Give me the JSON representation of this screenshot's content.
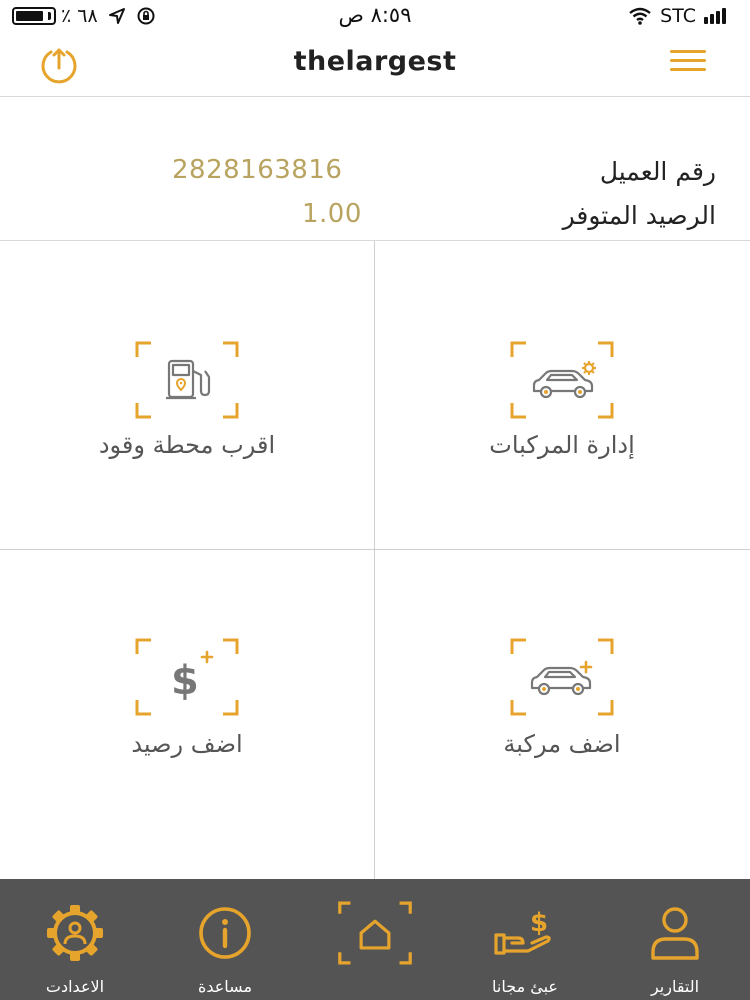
{
  "status_bar": {
    "carrier": "STC",
    "time": "٨:٥٩ ص",
    "battery": "٦٨ ٪"
  },
  "nav": {
    "title": "thelargest",
    "left_icon": "power-icon",
    "right_icon": "hamburger-menu-icon"
  },
  "account": {
    "customer_number_label": "رقم العميل",
    "customer_number": "2828163816",
    "balance_label": "الرصيد المتوفر",
    "balance": "1.00"
  },
  "tiles": [
    {
      "label": "إدارة المركبات",
      "icon": "car-settings-icon"
    },
    {
      "label": "اقرب محطة وقود",
      "icon": "fuel-station-icon"
    },
    {
      "label": "اضف مركبة",
      "icon": "add-car-icon"
    },
    {
      "label": "اضف رصيد",
      "icon": "add-balance-icon"
    }
  ],
  "tab_bar": {
    "items": [
      {
        "label": "التقارير",
        "icon": "user-icon"
      },
      {
        "label": "عبئ مجانا",
        "icon": "hand-money-icon"
      },
      {
        "label": "",
        "icon": "home-icon"
      },
      {
        "label": "مساعدة",
        "icon": "info-icon"
      },
      {
        "label": "الاعدادت",
        "icon": "settings-gear-icon"
      }
    ]
  },
  "colors": {
    "accent": "#e6a42c",
    "value_text": "#b8a460",
    "tab_bar_bg": "#545454",
    "icon_gray": "#777777"
  }
}
